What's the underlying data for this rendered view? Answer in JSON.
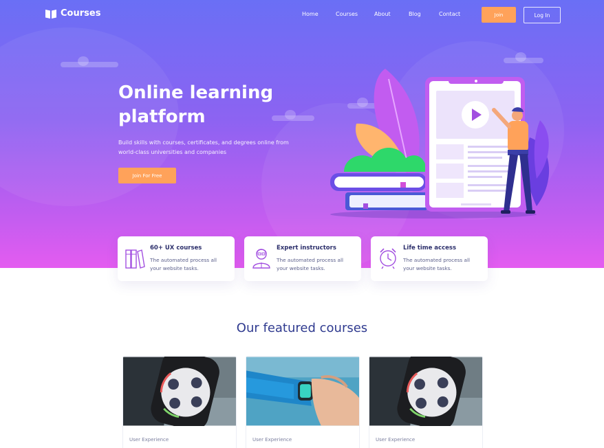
{
  "brand": {
    "name": "Courses"
  },
  "nav": {
    "links": [
      "Home",
      "Courses",
      "About",
      "Blog",
      "Contact"
    ],
    "join_label": "Join",
    "login_label": "Log In"
  },
  "hero": {
    "title_line1": "Online learning",
    "title_line2": "platform",
    "subtitle": "Build skills with courses, certificates, and degrees online from world-class universities and companies",
    "cta_label": "Join For Free"
  },
  "features": [
    {
      "icon": "books-icon",
      "title": "60+ UX courses",
      "desc": "The automated process all your website tasks."
    },
    {
      "icon": "instructor-icon",
      "title": "Expert instructors",
      "desc": "The automated process all your website tasks."
    },
    {
      "icon": "alarm-clock-icon",
      "title": "Life time access",
      "desc": "The automated process all your website tasks."
    }
  ],
  "featured": {
    "heading": "Our featured courses",
    "courses": [
      {
        "category": "User Experience",
        "image": "smartwatch-closeup"
      },
      {
        "category": "User Experience",
        "image": "smartwatch-on-wrist"
      },
      {
        "category": "User Experience",
        "image": "smartwatch-closeup"
      }
    ]
  },
  "colors": {
    "accent_orange": "#ffa25a",
    "hero_gradient_top": "#6a6ff5",
    "hero_gradient_bottom": "#e45cf0",
    "heading_blue": "#2f3a8f"
  }
}
